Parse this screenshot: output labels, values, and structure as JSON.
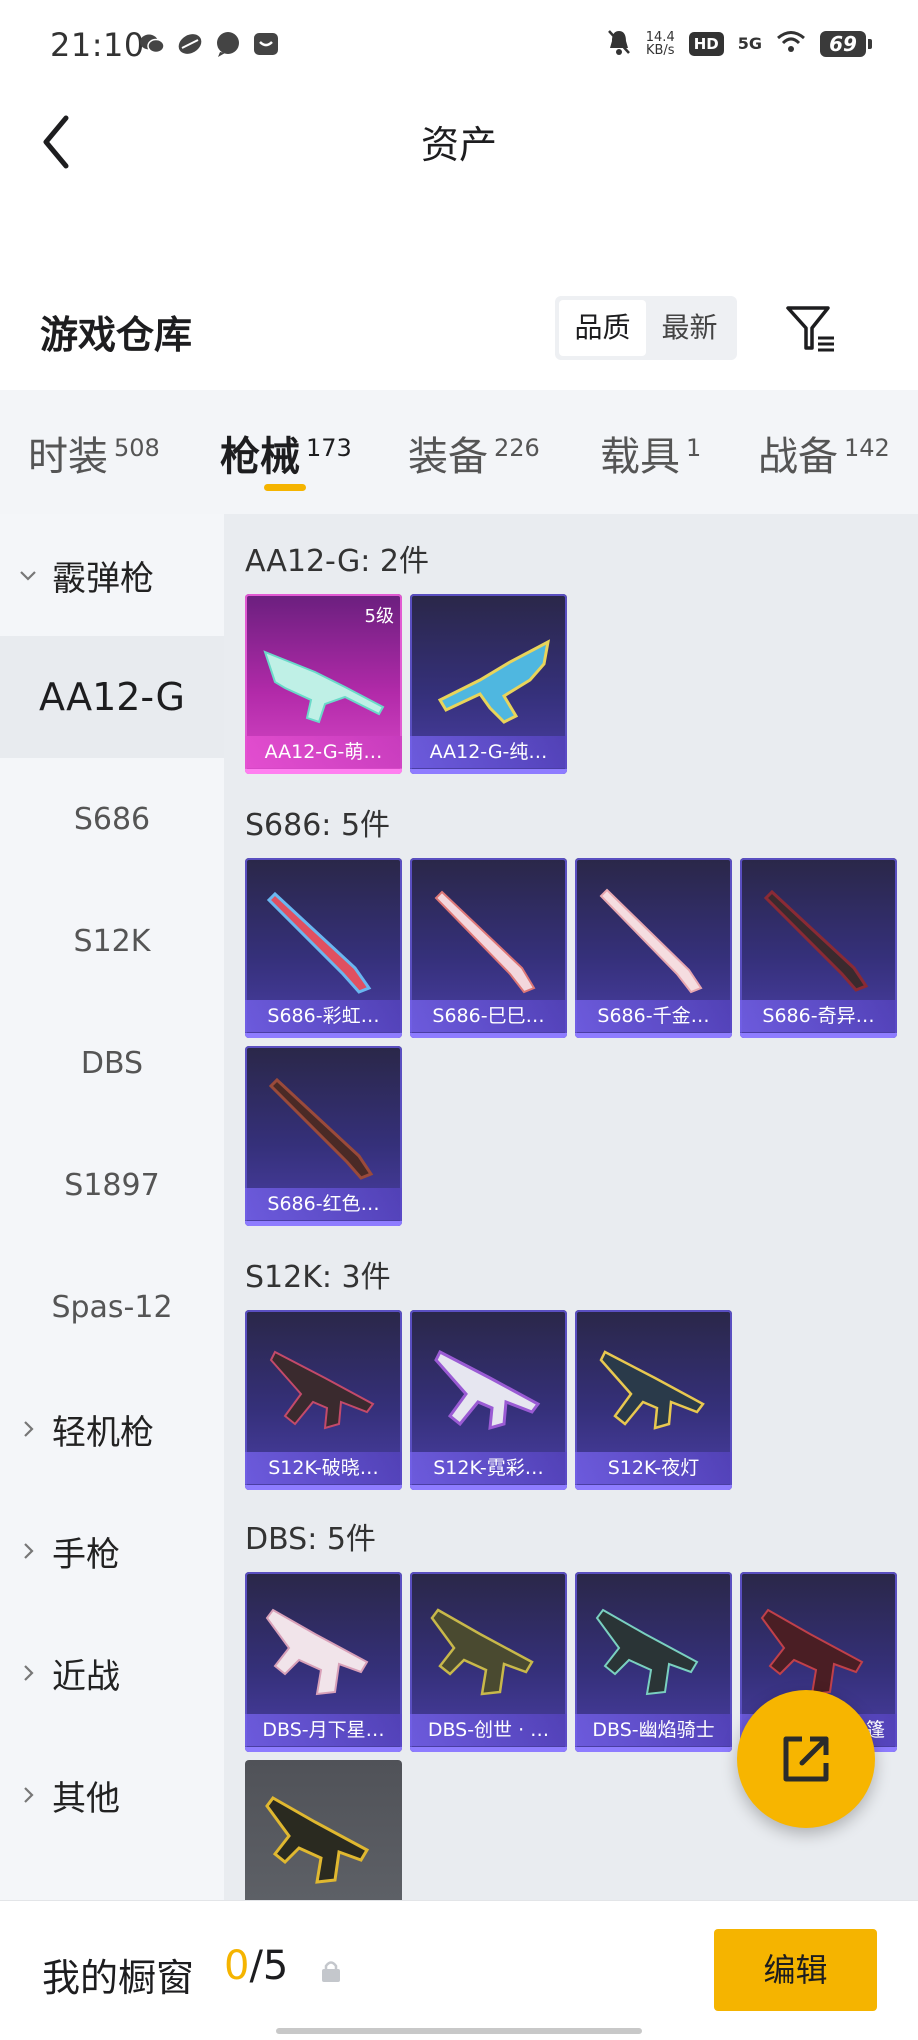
{
  "status_bar": {
    "time": "21:10",
    "net_speed_value": "14.4",
    "net_speed_unit": "KB/s",
    "hd": "HD",
    "signal": "5G",
    "battery": "69",
    "icons": [
      "wechat-icon",
      "app-icon",
      "chat-icon",
      "message-icon",
      "mute-bell-icon",
      "wifi-icon"
    ]
  },
  "header": {
    "title": "资产",
    "back_icon": "chevron-left-icon"
  },
  "warehouse": {
    "title": "游戏仓库",
    "sort_options": [
      "品质",
      "最新"
    ],
    "sort_selected": "品质",
    "filter_icon": "filter-icon"
  },
  "tabs": [
    {
      "label": "时装",
      "count": "508"
    },
    {
      "label": "枪械",
      "count": "173",
      "active": true
    },
    {
      "label": "装备",
      "count": "226"
    },
    {
      "label": "载具",
      "count": "1"
    },
    {
      "label": "战备",
      "count": "142"
    }
  ],
  "sidebar": {
    "items": [
      {
        "label": "霰弹枪",
        "type": "group",
        "expanded": true
      },
      {
        "label": "AA12-G",
        "type": "sub",
        "active": true
      },
      {
        "label": "S686",
        "type": "sub"
      },
      {
        "label": "S12K",
        "type": "sub"
      },
      {
        "label": "DBS",
        "type": "sub"
      },
      {
        "label": "S1897",
        "type": "sub"
      },
      {
        "label": "Spas-12",
        "type": "sub"
      },
      {
        "label": "轻机枪",
        "type": "group"
      },
      {
        "label": "手枪",
        "type": "group"
      },
      {
        "label": "近战",
        "type": "group"
      },
      {
        "label": "其他",
        "type": "group"
      }
    ]
  },
  "groups": [
    {
      "label": "AA12-G: 2件",
      "items": [
        {
          "name": "AA12-G-萌…",
          "level": "5级",
          "color": "pink"
        },
        {
          "name": "AA12-G-纯…"
        }
      ]
    },
    {
      "label": "S686: 5件",
      "items": [
        {
          "name": "S686-彩虹…"
        },
        {
          "name": "S686-巳巳…"
        },
        {
          "name": "S686-千金…"
        },
        {
          "name": "S686-奇异…"
        },
        {
          "name": "S686-红色…"
        }
      ]
    },
    {
      "label": "S12K: 3件",
      "items": [
        {
          "name": "S12K-破晓…"
        },
        {
          "name": "S12K-霓彩…"
        },
        {
          "name": "S12K-夜灯"
        }
      ]
    },
    {
      "label": "DBS: 5件",
      "items": [
        {
          "name": "DBS-月下星…"
        },
        {
          "name": "DBS-创世 · …"
        },
        {
          "name": "DBS-幽焰骑士"
        },
        {
          "name": "篷"
        },
        {
          "name": "",
          "color": "gray"
        }
      ]
    }
  ],
  "fab": {
    "icon": "share-export-icon"
  },
  "bottom_bar": {
    "title": "我的橱窗",
    "count_current": "0",
    "count_total": "/5",
    "lock_icon": "lock-icon",
    "edit_label": "编辑"
  },
  "colors": {
    "accent": "#F5B400",
    "card_purple": "#4B3FA6",
    "card_pink": "#D84AC8"
  }
}
